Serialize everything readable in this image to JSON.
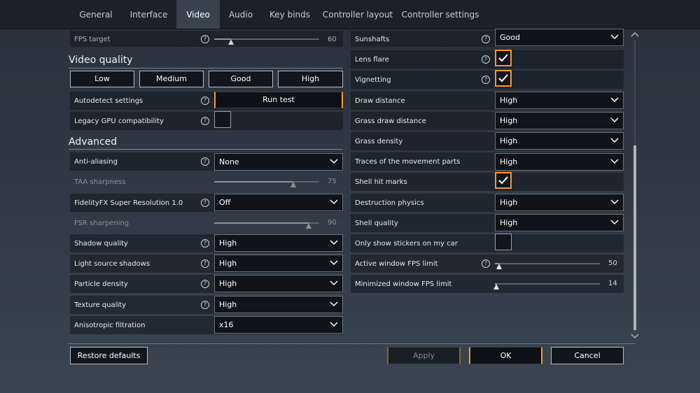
{
  "tabs": [
    {
      "label": "General",
      "active": false
    },
    {
      "label": "Interface",
      "active": false
    },
    {
      "label": "Video",
      "active": true
    },
    {
      "label": "Audio",
      "active": false
    },
    {
      "label": "Key binds",
      "active": false
    },
    {
      "label": "Controller layout",
      "active": false
    },
    {
      "label": "Controller settings",
      "active": false
    }
  ],
  "left": {
    "fps_target": {
      "label": "FPS target",
      "value": "60"
    },
    "video_quality": {
      "title": "Video quality",
      "presets": [
        "Low",
        "Medium",
        "Good",
        "High"
      ],
      "autodetect_label": "Autodetect settings",
      "run_test_label": "Run test",
      "legacy_gpu_label": "Legacy GPU compatibility",
      "legacy_gpu_checked": false
    },
    "advanced": {
      "title": "Advanced",
      "anti_aliasing": {
        "label": "Anti-aliasing",
        "value": "None"
      },
      "taa_sharpness": {
        "label": "TAA sharpness",
        "value": "75"
      },
      "fsr": {
        "label": "FidelityFX Super Resolution 1.0",
        "value": "Off"
      },
      "fsr_sharpening": {
        "label": "FSR sharpening",
        "value": "90"
      },
      "shadow_quality": {
        "label": "Shadow quality",
        "value": "High"
      },
      "light_source_shadows": {
        "label": "Light source shadows",
        "value": "High"
      },
      "particle_density": {
        "label": "Particle density",
        "value": "High"
      },
      "texture_quality": {
        "label": "Texture quality",
        "value": "High"
      },
      "anisotropic": {
        "label": "Anisotropic filtration",
        "value": "x16"
      }
    }
  },
  "right": {
    "sunshafts": {
      "label": "Sunshafts",
      "value": "Good"
    },
    "lens_flare": {
      "label": "Lens flare",
      "checked": true
    },
    "vignetting": {
      "label": "Vignetting",
      "checked": true
    },
    "draw_distance": {
      "label": "Draw distance",
      "value": "High"
    },
    "grass_draw_distance": {
      "label": "Grass draw distance",
      "value": "High"
    },
    "grass_density": {
      "label": "Grass density",
      "value": "High"
    },
    "traces": {
      "label": "Traces of the movement parts",
      "value": "High"
    },
    "shell_hit_marks": {
      "label": "Shell hit marks",
      "checked": true
    },
    "destruction_physics": {
      "label": "Destruction physics",
      "value": "High"
    },
    "shell_quality": {
      "label": "Shell quality",
      "value": "High"
    },
    "stickers": {
      "label": "Only show stickers on my car",
      "checked": false
    },
    "active_fps": {
      "label": "Active window FPS limit",
      "value": "50"
    },
    "minimized_fps": {
      "label": "Minimized window FPS limit",
      "value": "14"
    }
  },
  "footer": {
    "restore_label": "Restore defaults",
    "apply_label": "Apply",
    "ok_label": "OK",
    "cancel_label": "Cancel"
  },
  "slider_levels": {
    "fps_target": 0.16,
    "taa_sharpness": 0.75,
    "fsr_sharpening": 0.9,
    "active_fps": 0.04,
    "minimized_fps": 0.01
  },
  "icons": {
    "help": "question-circle-icon",
    "chevron": "chevron-down-icon",
    "check": "checkmark-icon",
    "scroll_up": "chevron-up-icon",
    "scroll_down": "chevron-down-icon"
  },
  "colors": {
    "accent": "#f29a2e",
    "panel_row": "#12161c",
    "tab_bar": "#1c2129",
    "active_tab": "#38424f"
  }
}
